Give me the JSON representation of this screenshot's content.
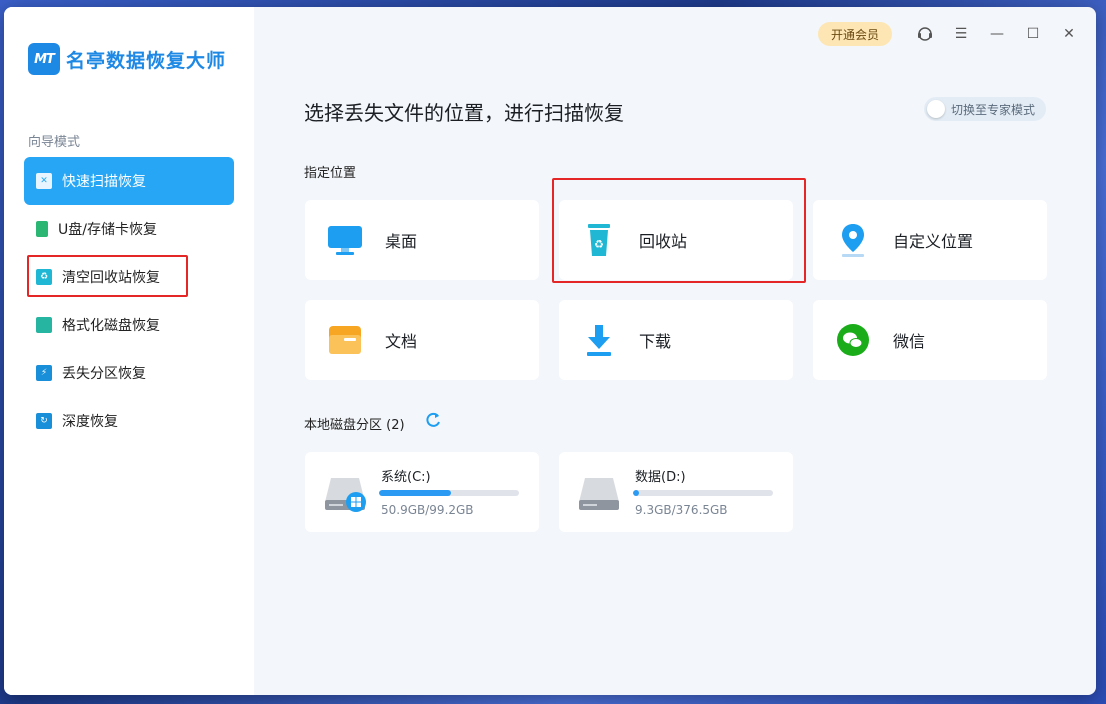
{
  "app": {
    "name": "名亭数据恢复大师",
    "logo_mark": "MT",
    "vip_button": "开通会员",
    "expert_toggle": "切换至专家模式"
  },
  "sidebar": {
    "mode_label": "向导模式",
    "items": [
      {
        "label": "快速扫描恢复",
        "icon": "folder-scan-icon",
        "active": true
      },
      {
        "label": "U盘/存储卡恢复",
        "icon": "sd-card-icon",
        "active": false
      },
      {
        "label": "清空回收站恢复",
        "icon": "recycle-bin-icon",
        "active": false
      },
      {
        "label": "格式化磁盘恢复",
        "icon": "format-disk-icon",
        "active": false
      },
      {
        "label": "丢失分区恢复",
        "icon": "partition-icon",
        "active": false
      },
      {
        "label": "深度恢复",
        "icon": "deep-scan-icon",
        "active": false
      }
    ]
  },
  "main": {
    "heading": "选择丢失文件的位置，进行扫描恢复",
    "locations_label": "指定位置",
    "locations": [
      {
        "label": "桌面",
        "icon": "desktop-monitor-icon"
      },
      {
        "label": "回收站",
        "icon": "recycle-bin-icon"
      },
      {
        "label": "自定义位置",
        "icon": "location-pin-icon"
      },
      {
        "label": "文档",
        "icon": "folder-icon"
      },
      {
        "label": "下载",
        "icon": "download-arrow-icon"
      },
      {
        "label": "微信",
        "icon": "wechat-icon"
      }
    ],
    "disks_label": "本地磁盘分区 (2)",
    "disks": [
      {
        "name": "系统(C:)",
        "size": "50.9GB/99.2GB",
        "used_fraction": 0.513,
        "icon": "system-drive-icon"
      },
      {
        "name": "数据(D:)",
        "size": "9.3GB/376.5GB",
        "used_fraction": 0.025,
        "icon": "hard-drive-icon"
      }
    ]
  },
  "colors": {
    "accent": "#26a6f5",
    "brand": "#1e88e5",
    "highlight_box": "#e52626"
  }
}
